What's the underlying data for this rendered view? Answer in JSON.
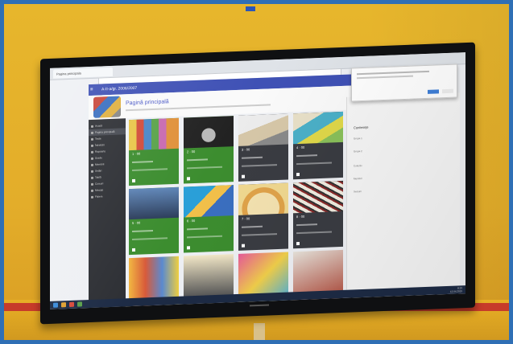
{
  "browser": {
    "tab_title": "Pagina principala"
  },
  "app": {
    "title": "A-II-a/gr. 2006/2007",
    "subject": "Pagină principală",
    "menu_glyph": "≡"
  },
  "sidebar": {
    "items": [
      "Acasă",
      "Pagina principală",
      "Teste",
      "Întrebări",
      "Rapoarte",
      "Grade",
      "Membrii",
      "Setări",
      "Tablă",
      "Cursuri",
      "Mesaje",
      "Fișiere"
    ]
  },
  "cards": [
    {
      "num": "1 · 00",
      "theme": "green"
    },
    {
      "num": "2 · 00",
      "theme": "green"
    },
    {
      "num": "3 · 00",
      "theme": "dark"
    },
    {
      "num": "4 · 00",
      "theme": "dark"
    },
    {
      "num": "5 · 00",
      "theme": "green"
    },
    {
      "num": "6 · 00",
      "theme": "green"
    },
    {
      "num": "7 · 00",
      "theme": "dark"
    },
    {
      "num": "8 · 00",
      "theme": "dark"
    }
  ],
  "right_panel": {
    "heading": "Conferințe",
    "rows": [
      "Grupa 1",
      "Grupa 2",
      "Colectiv",
      "Membrii",
      "Sesiuni"
    ]
  },
  "taskbar": {
    "time": "8:15",
    "date": "12.04.2015"
  },
  "colors": {
    "wall": "#e5b12a",
    "appbar": "#3f51b5",
    "card_green": "#3c8d2f",
    "card_dark": "#3a3c42",
    "bezel": "#0f1012"
  }
}
